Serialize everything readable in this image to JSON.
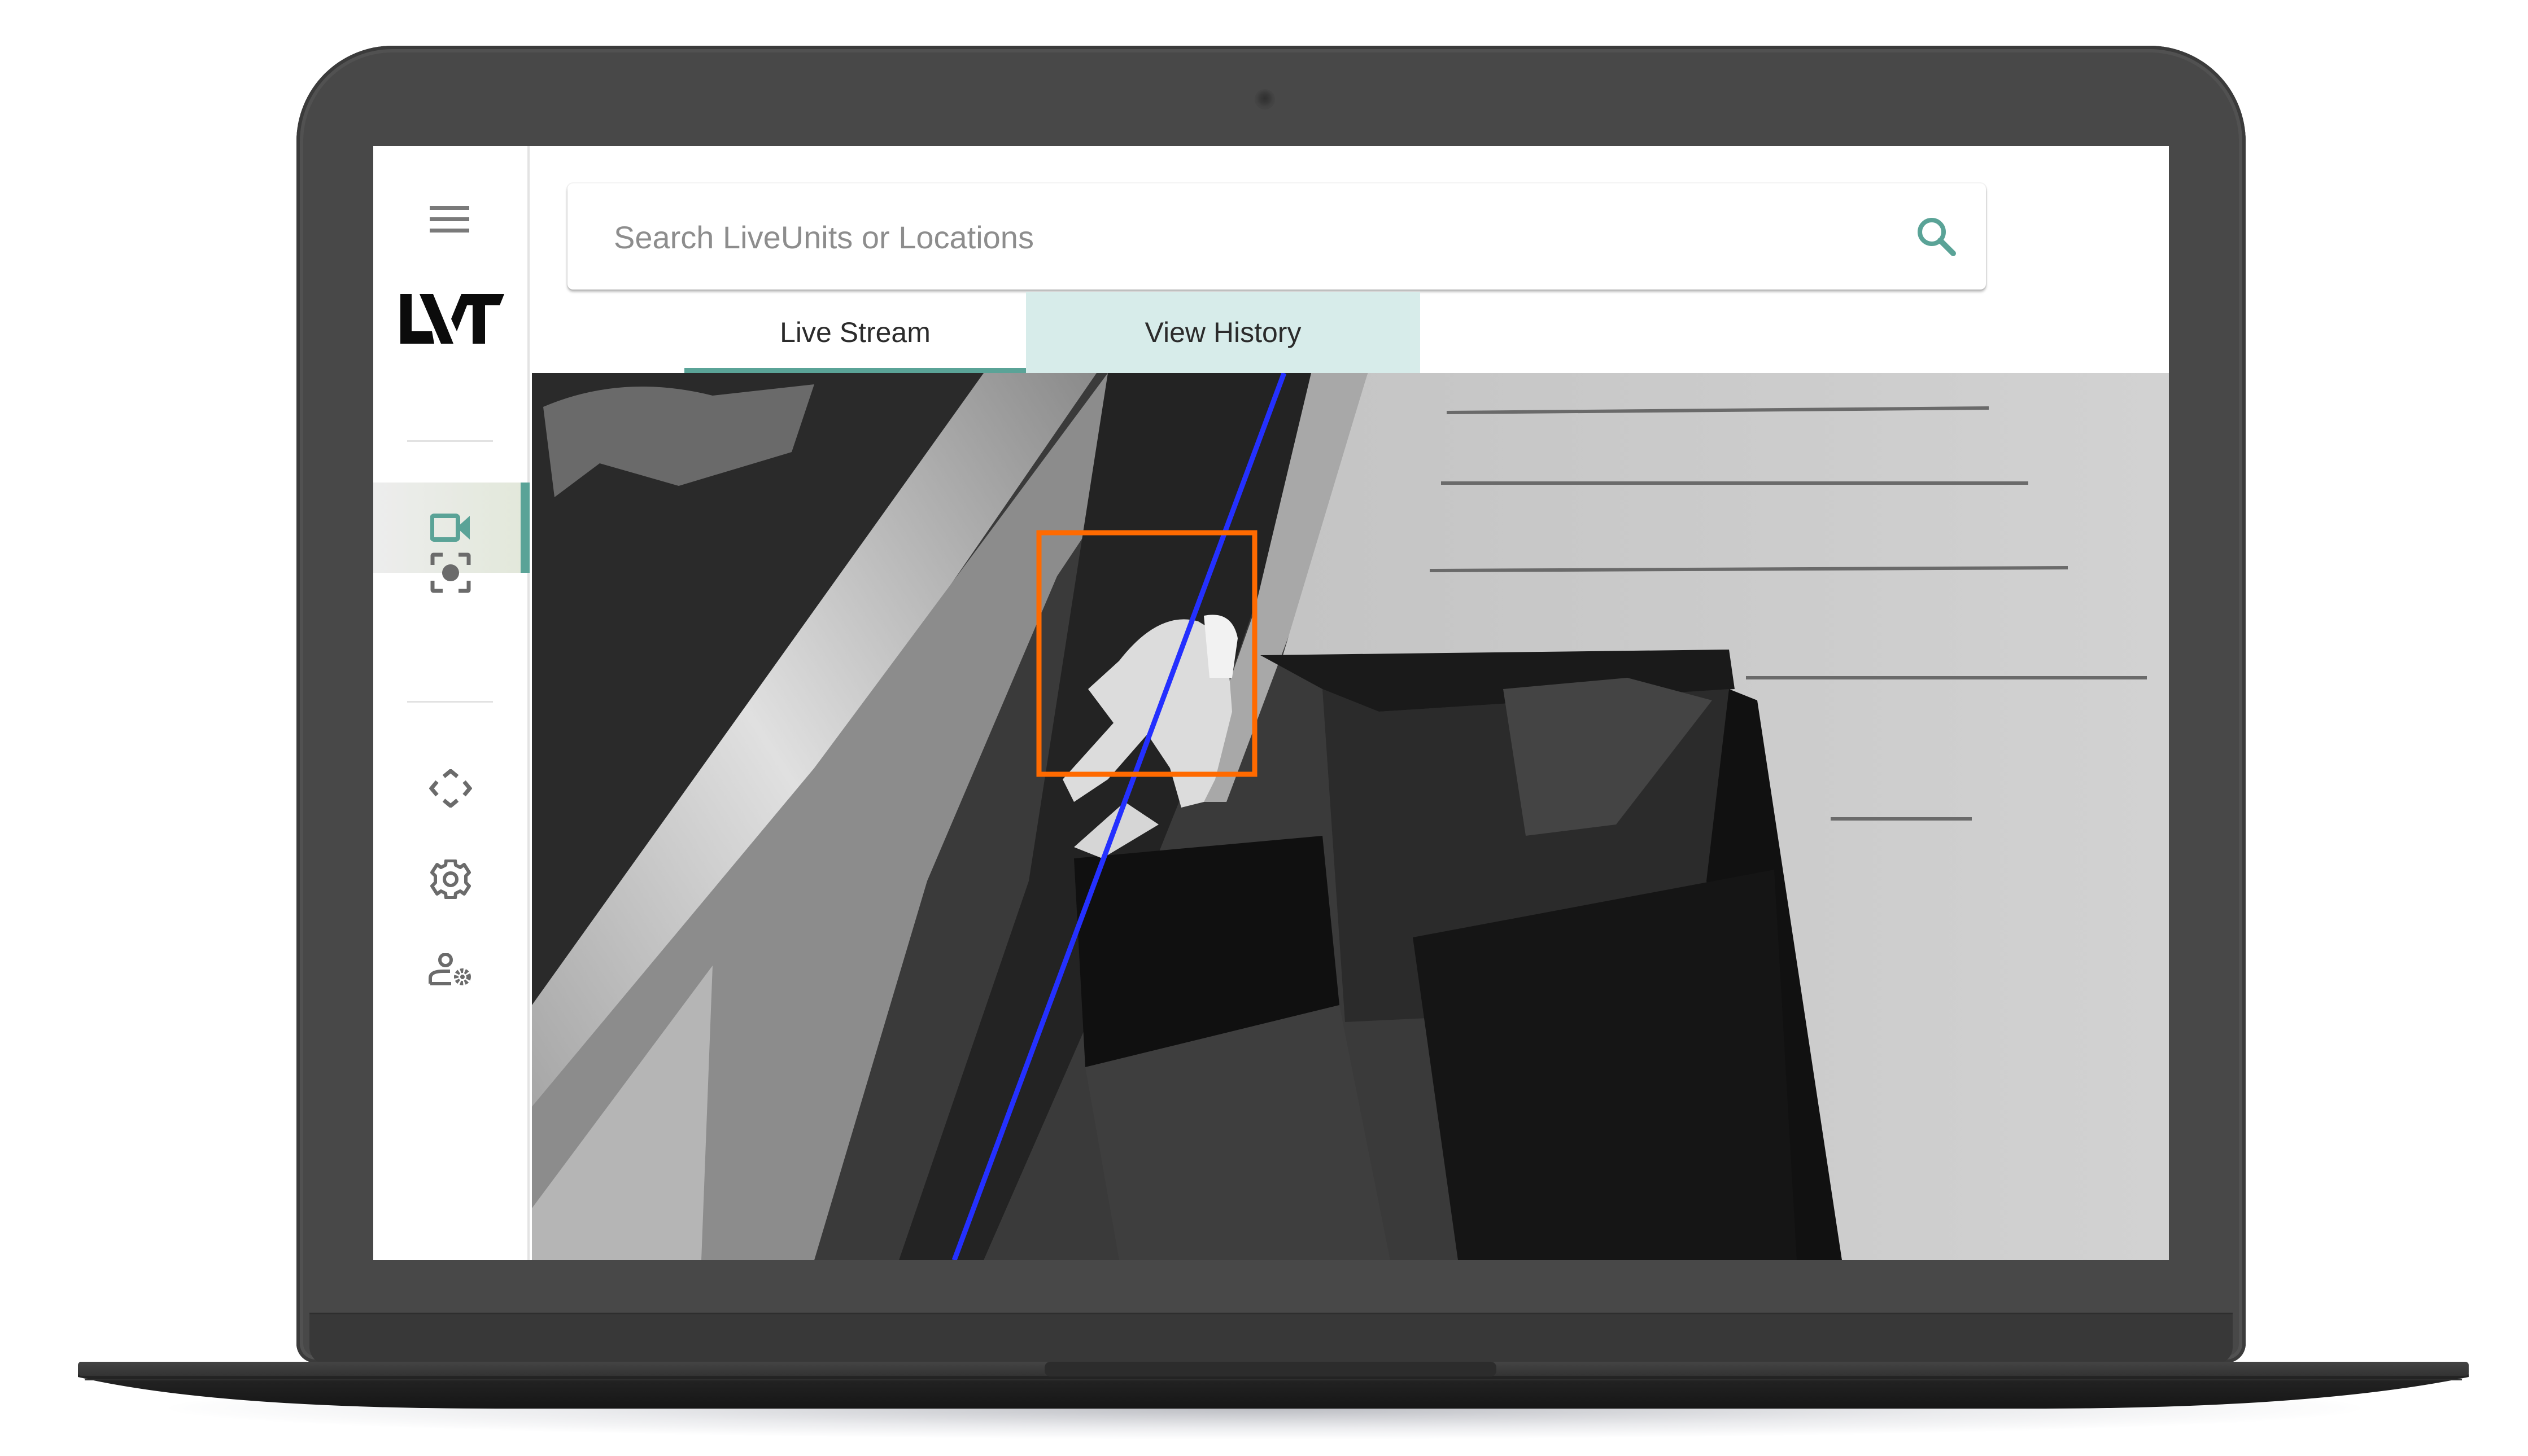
{
  "device": {
    "type": "laptop-mockup"
  },
  "app": {
    "brand": "LVT",
    "sidebar": {
      "menu_icon": "hamburger-menu-icon",
      "items": [
        {
          "id": "live-video",
          "icon": "video-camera-icon",
          "active": true
        },
        {
          "id": "snapshot",
          "icon": "focus-capture-icon",
          "active": false
        },
        {
          "id": "pan-move",
          "icon": "move-arrows-icon",
          "active": false
        },
        {
          "id": "settings",
          "icon": "gear-icon",
          "active": false
        },
        {
          "id": "user-settings",
          "icon": "user-gear-icon",
          "active": false
        }
      ]
    },
    "search": {
      "placeholder": "Search LiveUnits or Locations",
      "value": "",
      "icon": "search-icon"
    },
    "tabs": [
      {
        "label": "Live Stream",
        "active": true
      },
      {
        "label": "View History",
        "active": false
      }
    ],
    "video": {
      "description": "Grayscale live camera feed of a person crouching near a dumpster",
      "overlays": {
        "tripwire_line": {
          "color": "#2430ff"
        },
        "detection_box": {
          "color": "#ff6a00",
          "label": ""
        }
      }
    },
    "colors": {
      "accent": "#5aa397",
      "tab_inactive_bg": "#d7ecea",
      "sidebar_active_bg": "#e6eadf",
      "icon_gray": "#6b6b6b",
      "placeholder_gray": "#8d8d8d"
    }
  }
}
